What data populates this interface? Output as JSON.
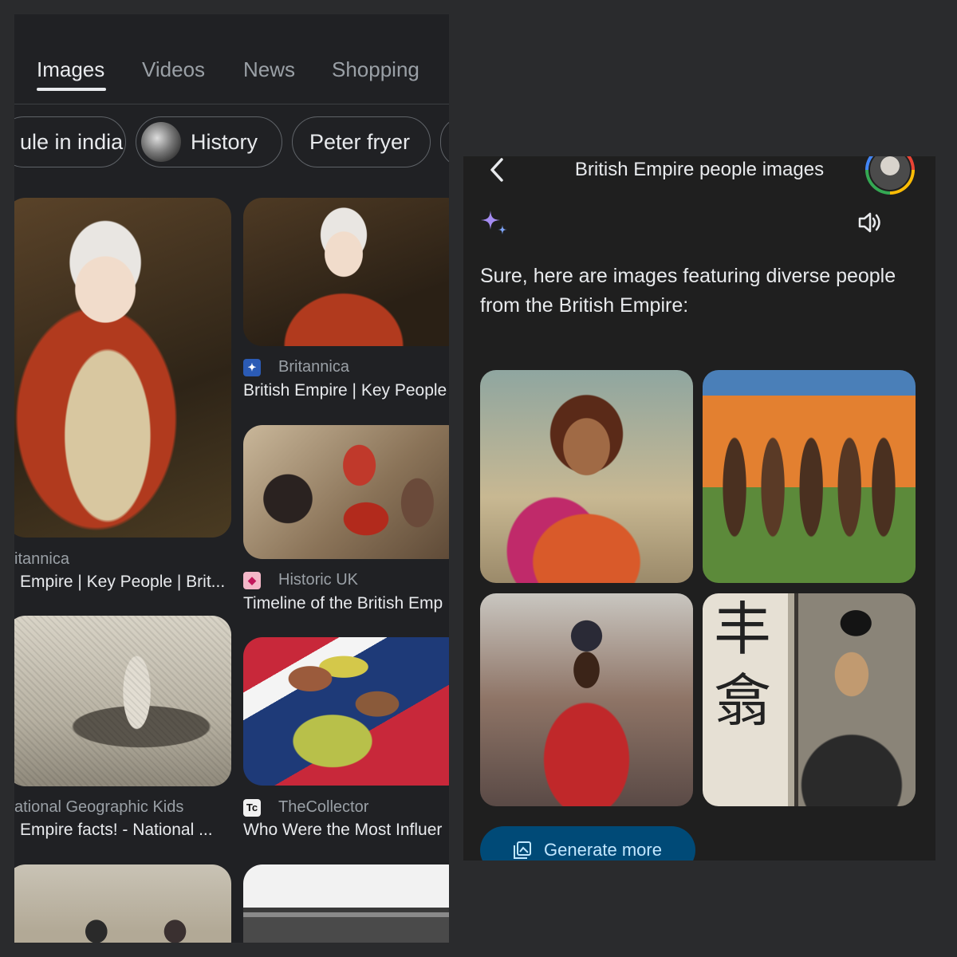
{
  "search": {
    "tabs": [
      {
        "label": "Images",
        "active": true
      },
      {
        "label": "Videos",
        "active": false
      },
      {
        "label": "News",
        "active": false
      },
      {
        "label": "Shopping",
        "active": false
      }
    ],
    "chips": [
      "ule in india",
      "History",
      "Peter fryer"
    ],
    "results": [
      {
        "source": "itannica",
        "title": "Empire | Key People | Brit..."
      },
      {
        "source": "Britannica",
        "title": "British Empire | Key People"
      },
      {
        "source": "Historic UK",
        "title": "Timeline of the British Emp"
      },
      {
        "source": "ational Geographic Kids",
        "title": "Empire facts! - National ..."
      },
      {
        "source": "TheCollector",
        "title": "Who Were the Most Influer"
      }
    ]
  },
  "assistant": {
    "title": "British Empire people images",
    "response": "Sure, here are images featuring diverse people from the British Empire:",
    "generate_more_label": "Generate more",
    "calligraphy": "丰\n翕",
    "icons": [
      "back-arrow-icon",
      "sparkle-icon",
      "speaker-icon",
      "image-stack-icon"
    ]
  },
  "colors": {
    "left_background": "#202124",
    "right_background": "#1f1f1f",
    "accent_button": "#004a77",
    "accent_button_text": "#c2e7ff",
    "sparkle": "#a58cf2"
  }
}
